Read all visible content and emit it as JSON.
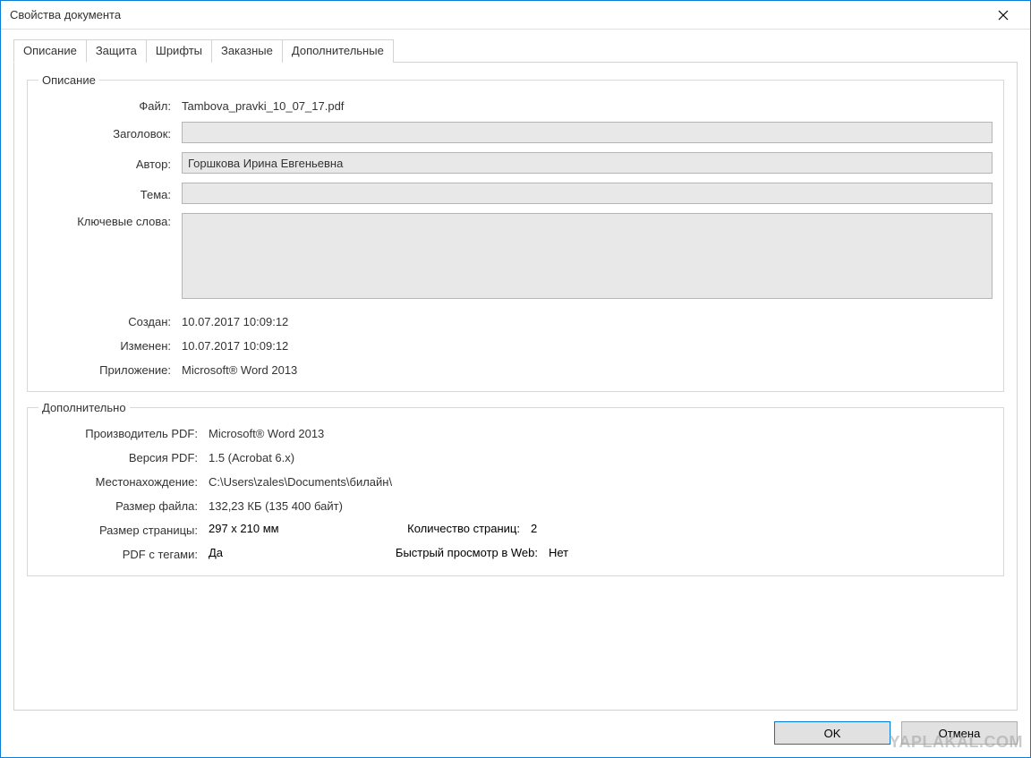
{
  "window": {
    "title": "Свойства документа"
  },
  "tabs": {
    "description": "Описание",
    "security": "Защита",
    "fonts": "Шрифты",
    "custom": "Заказные",
    "additional": "Дополнительные",
    "active": "description"
  },
  "groups": {
    "description": "Описание",
    "additional": "Дополнительно"
  },
  "description": {
    "file_label": "Файл:",
    "file_value": "Tambova_pravki_10_07_17.pdf",
    "title_label": "Заголовок:",
    "title_value": "",
    "author_label": "Автор:",
    "author_value": "Горшкова Ирина Евгеньевна",
    "subject_label": "Тема:",
    "subject_value": "",
    "keywords_label": "Ключевые слова:",
    "keywords_value": "",
    "created_label": "Создан:",
    "created_value": "10.07.2017 10:09:12",
    "modified_label": "Изменен:",
    "modified_value": "10.07.2017 10:09:12",
    "application_label": "Приложение:",
    "application_value": "Microsoft® Word 2013"
  },
  "additional": {
    "producer_label": "Производитель PDF:",
    "producer_value": "Microsoft® Word 2013",
    "version_label": "Версия PDF:",
    "version_value": "1.5 (Acrobat 6.x)",
    "location_label": "Местонахождение:",
    "location_value": "C:\\Users\\zales\\Documents\\билайн\\",
    "filesize_label": "Размер файла:",
    "filesize_value": "132,23 КБ (135 400 байт)",
    "pagesize_label": "Размер страницы:",
    "pagesize_value": "297 x 210 мм",
    "pagecount_label": "Количество страниц:",
    "pagecount_value": "2",
    "tagged_label": "PDF с тегами:",
    "tagged_value": "Да",
    "fastweb_label": "Быстрый просмотр в Web:",
    "fastweb_value": "Нет"
  },
  "buttons": {
    "ok": "OK",
    "cancel": "Отмена"
  },
  "watermark": "YAPLAKAL.COM"
}
